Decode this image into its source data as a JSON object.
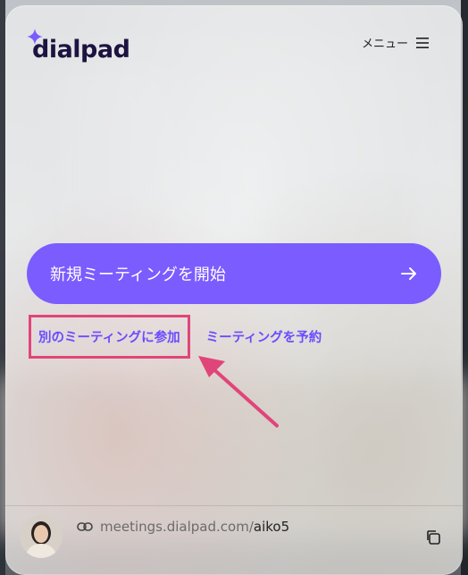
{
  "brand": {
    "logo_text": "dialpad",
    "accent": "#7b5cff",
    "link_color": "#6a4cff",
    "highlight": "#e0457a"
  },
  "header": {
    "menu_label": "メニュー",
    "menu_icon": "hamburger-icon"
  },
  "main": {
    "start_meeting_label": "新規ミーティングを開始",
    "start_icon": "arrow-right-icon",
    "join_meeting_label": "別のミーティングに参加",
    "schedule_meeting_label": "ミーティングを予約"
  },
  "footer": {
    "url_base": "meetings.dialpad.com/",
    "url_user": "aiko5",
    "link_icon": "chain-link-icon",
    "copy_icon": "copy-icon"
  }
}
